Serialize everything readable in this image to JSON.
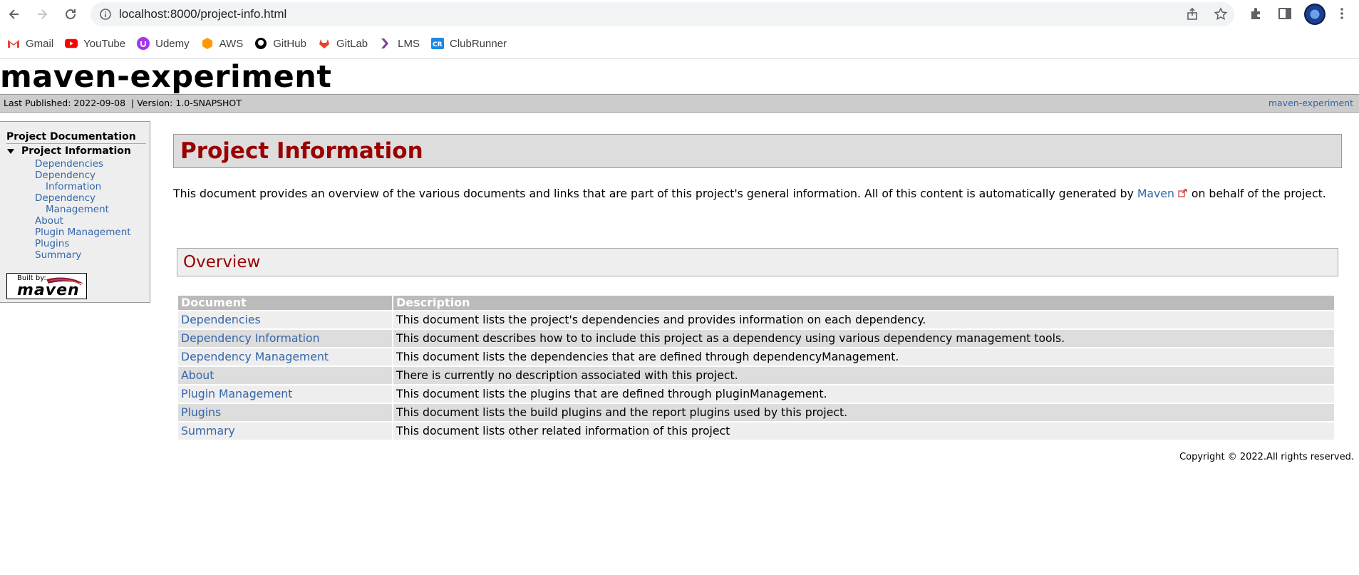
{
  "browser": {
    "url": "localhost:8000/project-info.html",
    "bookmarks": [
      {
        "label": "Gmail",
        "icon": "gmail-icon",
        "color": "#ea4335"
      },
      {
        "label": "YouTube",
        "icon": "youtube-icon",
        "color": "#ff0000"
      },
      {
        "label": "Udemy",
        "icon": "udemy-icon",
        "color": "#a435f0"
      },
      {
        "label": "AWS",
        "icon": "aws-icon",
        "color": "#f90"
      },
      {
        "label": "GitHub",
        "icon": "github-icon",
        "color": "#000000"
      },
      {
        "label": "GitLab",
        "icon": "gitlab-icon",
        "color": "#e24329"
      },
      {
        "label": "LMS",
        "icon": "lms-icon",
        "color": "#7b3fa0"
      },
      {
        "label": "ClubRunner",
        "icon": "clubrunner-icon",
        "color": "#1e88e5"
      }
    ]
  },
  "banner": {
    "title": "maven-experiment"
  },
  "breadcrumbs": {
    "published": "Last Published: 2022-09-08",
    "version": "Version: 1.0-SNAPSHOT",
    "right_link": "maven-experiment"
  },
  "menu": {
    "heading": "Project Documentation",
    "section": "Project Information",
    "items": [
      "Dependencies",
      "Dependency",
      "Information",
      "Dependency",
      "Management",
      "About",
      "Plugin Management",
      "Plugins",
      "Summary"
    ],
    "built_by": "Built by:",
    "built_by_brand": "maven"
  },
  "content": {
    "title": "Project Information",
    "intro_before": "This document provides an overview of the various documents and links that are part of this project's general information. All of this content is automatically generated by ",
    "intro_link": "Maven",
    "intro_after": " on behalf of the project.",
    "overview_title": "Overview",
    "table": {
      "headers": [
        "Document",
        "Description"
      ],
      "rows": [
        {
          "name": "Dependencies",
          "desc": "This document lists the project's dependencies and provides information on each dependency."
        },
        {
          "name": "Dependency Information",
          "desc": "This document describes how to to include this project as a dependency using various dependency management tools."
        },
        {
          "name": "Dependency Management",
          "desc": "This document lists the dependencies that are defined through dependencyManagement."
        },
        {
          "name": "About",
          "desc": "There is currently no description associated with this project."
        },
        {
          "name": "Plugin Management",
          "desc": "This document lists the plugins that are defined through pluginManagement."
        },
        {
          "name": "Plugins",
          "desc": "This document lists the build plugins and the report plugins used by this project."
        },
        {
          "name": "Summary",
          "desc": "This document lists other related information of this project"
        }
      ]
    }
  },
  "footer": {
    "copyright": "Copyright © 2022.All rights reserved."
  }
}
